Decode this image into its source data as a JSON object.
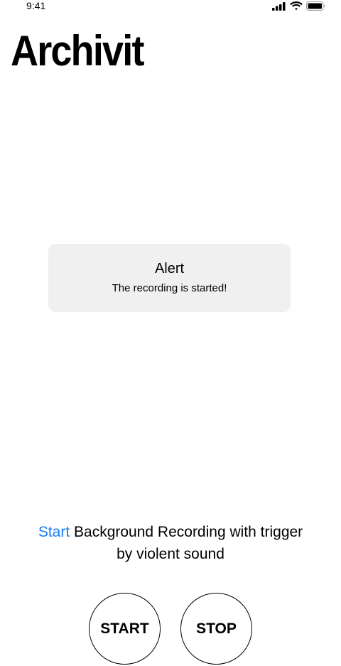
{
  "status_bar": {
    "time": "9:41",
    "icons": [
      "cellular-signal-icon",
      "wifi-icon",
      "battery-icon"
    ]
  },
  "app": {
    "title": "Archivit"
  },
  "alert": {
    "title": "Alert",
    "message": "The recording is started!"
  },
  "description": {
    "highlight": "Start",
    "line1_rest": " Background Recording with trigger",
    "line2": "by violent sound",
    "highlight_color": "#1a7cf2"
  },
  "buttons": {
    "start_label": "START",
    "stop_label": "STOP"
  }
}
